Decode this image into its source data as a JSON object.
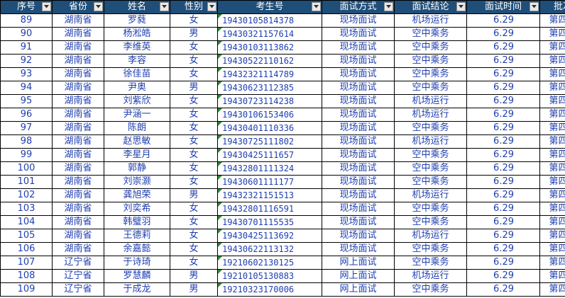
{
  "headers": [
    "序号",
    "省份",
    "姓名",
    "性别",
    "考生号",
    "面试方式",
    "面试结论",
    "面试时间",
    "批次"
  ],
  "rows": [
    [
      "89",
      "湖南省",
      "罗蕤",
      "女",
      "19430105814378",
      "现场面试",
      "机场运行",
      "6.29",
      "第四批"
    ],
    [
      "90",
      "湖南省",
      "杨淞皓",
      "男",
      "19430321157614",
      "现场面试",
      "空中乘务",
      "6.29",
      "第四批"
    ],
    [
      "91",
      "湖南省",
      "李维英",
      "女",
      "19430103113862",
      "现场面试",
      "空中乘务",
      "6.29",
      "第四批"
    ],
    [
      "92",
      "湖南省",
      "李容",
      "女",
      "19430522110162",
      "现场面试",
      "空中乘务",
      "6.29",
      "第四批"
    ],
    [
      "93",
      "湖南省",
      "徐佳苗",
      "女",
      "19432321114789",
      "现场面试",
      "空中乘务",
      "6.29",
      "第四批"
    ],
    [
      "94",
      "湖南省",
      "尹奥",
      "男",
      "19430623112385",
      "现场面试",
      "空中乘务",
      "6.29",
      "第四批"
    ],
    [
      "95",
      "湖南省",
      "刘紫欣",
      "女",
      "19430723114238",
      "现场面试",
      "机场运行",
      "6.29",
      "第四批"
    ],
    [
      "96",
      "湖南省",
      "尹涵一",
      "女",
      "19430106153406",
      "现场面试",
      "机场运行",
      "6.29",
      "第四批"
    ],
    [
      "97",
      "湖南省",
      "陈朗",
      "女",
      "19430401110336",
      "现场面试",
      "空中乘务",
      "6.29",
      "第四批"
    ],
    [
      "98",
      "湖南省",
      "赵思敏",
      "女",
      "19430725111802",
      "现场面试",
      "机场运行",
      "6.29",
      "第四批"
    ],
    [
      "99",
      "湖南省",
      "李星月",
      "女",
      "19430425111657",
      "现场面试",
      "空中乘务",
      "6.29",
      "第四批"
    ],
    [
      "100",
      "湖南省",
      "郭静",
      "女",
      "19432801111324",
      "现场面试",
      "空中乘务",
      "6.29",
      "第四批"
    ],
    [
      "101",
      "湖南省",
      "刘崇灏",
      "女",
      "19430601111177",
      "现场面试",
      "空中乘务",
      "6.29",
      "第四批"
    ],
    [
      "102",
      "湖南省",
      "龚旭荣",
      "男",
      "19432321151513",
      "现场面试",
      "机场运行",
      "6.29",
      "第四批"
    ],
    [
      "103",
      "湖南省",
      "刘奕希",
      "女",
      "19432801116591",
      "现场面试",
      "空中乘务",
      "6.29",
      "第四批"
    ],
    [
      "104",
      "湖南省",
      "韩璧羽",
      "女",
      "19430701115535",
      "现场面试",
      "空中乘务",
      "6.29",
      "第四批"
    ],
    [
      "105",
      "湖南省",
      "王德莉",
      "女",
      "19430425113692",
      "现场面试",
      "机场运行",
      "6.29",
      "第四批"
    ],
    [
      "106",
      "湖南省",
      "余嘉懿",
      "女",
      "19430622113132",
      "现场面试",
      "空中乘务",
      "6.29",
      "第四批"
    ],
    [
      "107",
      "辽宁省",
      "于诗琦",
      "女",
      "19210602130125",
      "网上面试",
      "空中乘务",
      "6.29",
      "第四批"
    ],
    [
      "108",
      "辽宁省",
      "罗慧麟",
      "男",
      "19210105130883",
      "网上面试",
      "机场运行",
      "6.29",
      "第四批"
    ],
    [
      "109",
      "辽宁省",
      "于成龙",
      "男",
      "19210323170006",
      "网上面试",
      "空中乘务",
      "6.29",
      "第四批"
    ]
  ]
}
